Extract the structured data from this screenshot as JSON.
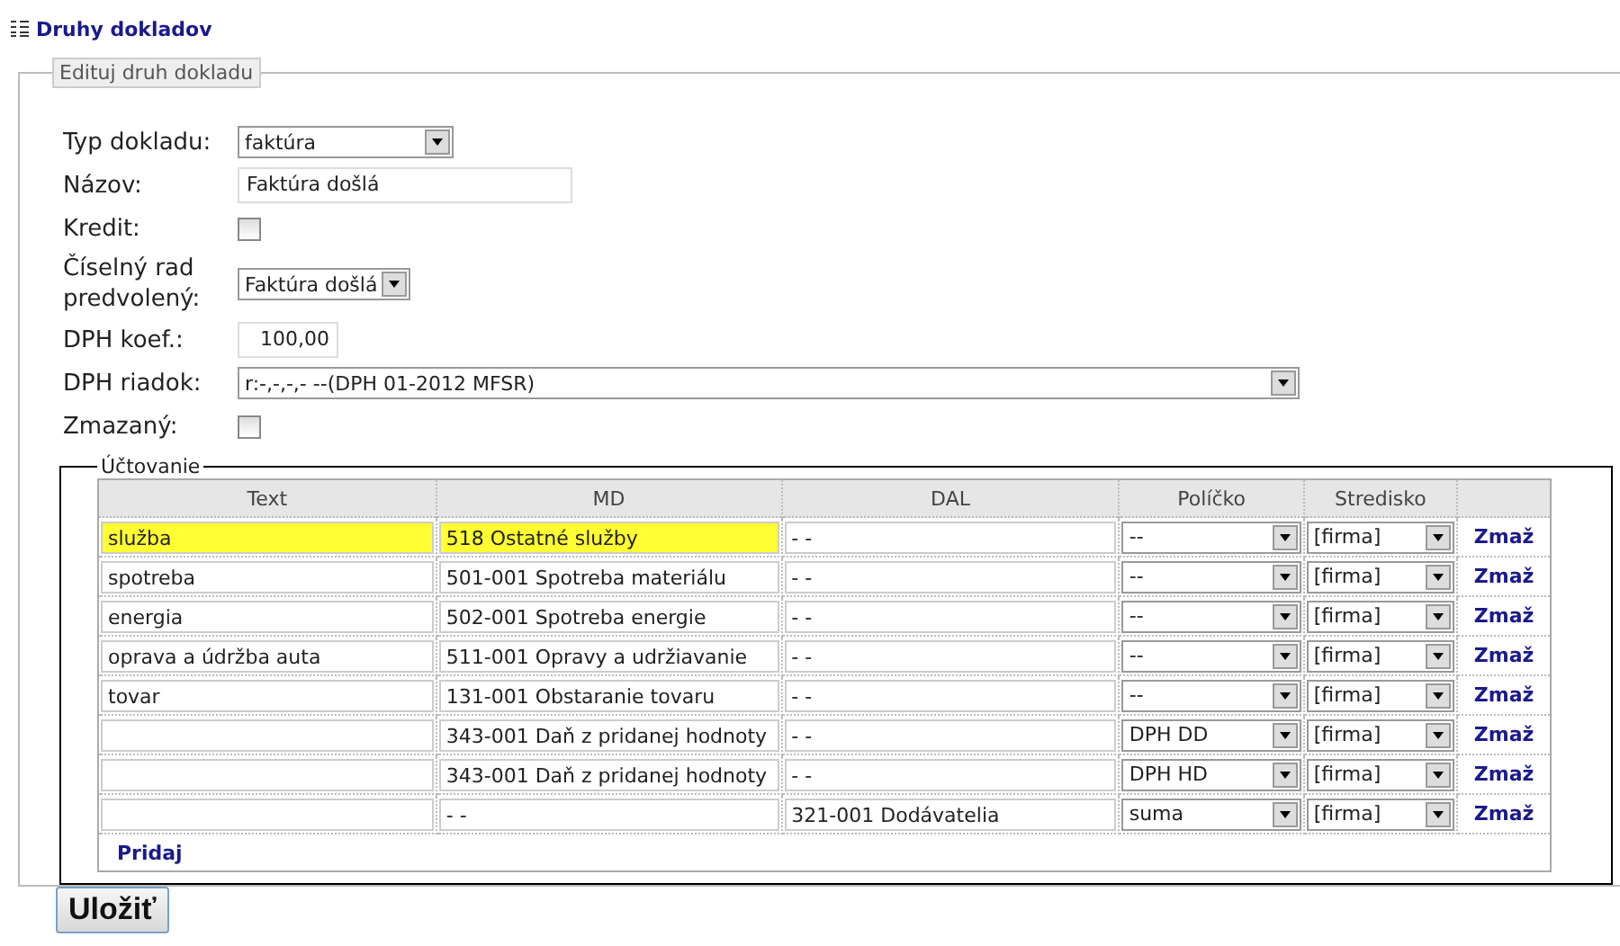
{
  "header": {
    "title": "Druhy dokladov"
  },
  "form": {
    "legend": "Edituj druh dokladu",
    "fields": [
      {
        "kind": "select",
        "label": "Typ dokladu:",
        "value": "faktúra"
      },
      {
        "kind": "text",
        "label": "Názov:",
        "value": "Faktúra došlá"
      },
      {
        "kind": "checkbox",
        "label": "Kredit:",
        "checked": false
      },
      {
        "kind": "select",
        "label": "Číselný rad predvolený:",
        "value": "Faktúra došlá"
      },
      {
        "kind": "number",
        "label": "DPH koef.:",
        "value": "100,00"
      },
      {
        "kind": "select",
        "label": "DPH riadok:",
        "value": "r:-,-,-,- --(DPH 01-2012 MFSR)"
      },
      {
        "kind": "checkbox",
        "label": "Zmazaný:",
        "checked": false
      }
    ]
  },
  "accounting": {
    "legend": "Účtovanie",
    "columns": [
      "Text",
      "MD",
      "DAL",
      "Políčko",
      "Stredisko"
    ],
    "rows": [
      {
        "text": "služba",
        "md": "518 Ostatné služby",
        "dal": "- -",
        "policko": "--",
        "stredisko": "[firma]",
        "delete": "Zmaž",
        "highlighted": true
      },
      {
        "text": "spotreba",
        "md": "501-001 Spotreba materiálu",
        "dal": "- -",
        "policko": "--",
        "stredisko": "[firma]",
        "delete": "Zmaž",
        "highlighted": false
      },
      {
        "text": "energia",
        "md": "502-001 Spotreba energie",
        "dal": "- -",
        "policko": "--",
        "stredisko": "[firma]",
        "delete": "Zmaž",
        "highlighted": false
      },
      {
        "text": "oprava a údržba auta",
        "md": "511-001 Opravy a udržiavanie",
        "dal": "- -",
        "policko": "--",
        "stredisko": "[firma]",
        "delete": "Zmaž",
        "highlighted": false
      },
      {
        "text": "tovar",
        "md": "131-001 Obstaranie tovaru",
        "dal": "- -",
        "policko": "--",
        "stredisko": "[firma]",
        "delete": "Zmaž",
        "highlighted": false
      },
      {
        "md": "343-001 Daň z pridanej hodnoty",
        "dal": "- -",
        "policko": "DPH DD",
        "stredisko": "[firma]",
        "delete": "Zmaž",
        "highlighted": false
      },
      {
        "md": "343-001 Daň z pridanej hodnoty",
        "dal": "- -",
        "policko": "DPH HD",
        "stredisko": "[firma]",
        "delete": "Zmaž",
        "highlighted": false
      },
      {
        "md": "- -",
        "dal": "321-001 Dodávatelia",
        "policko": "suma",
        "stredisko": "[firma]",
        "delete": "Zmaž",
        "highlighted": false
      }
    ],
    "add_link": "Pridaj"
  },
  "save_button": "Uložiť"
}
